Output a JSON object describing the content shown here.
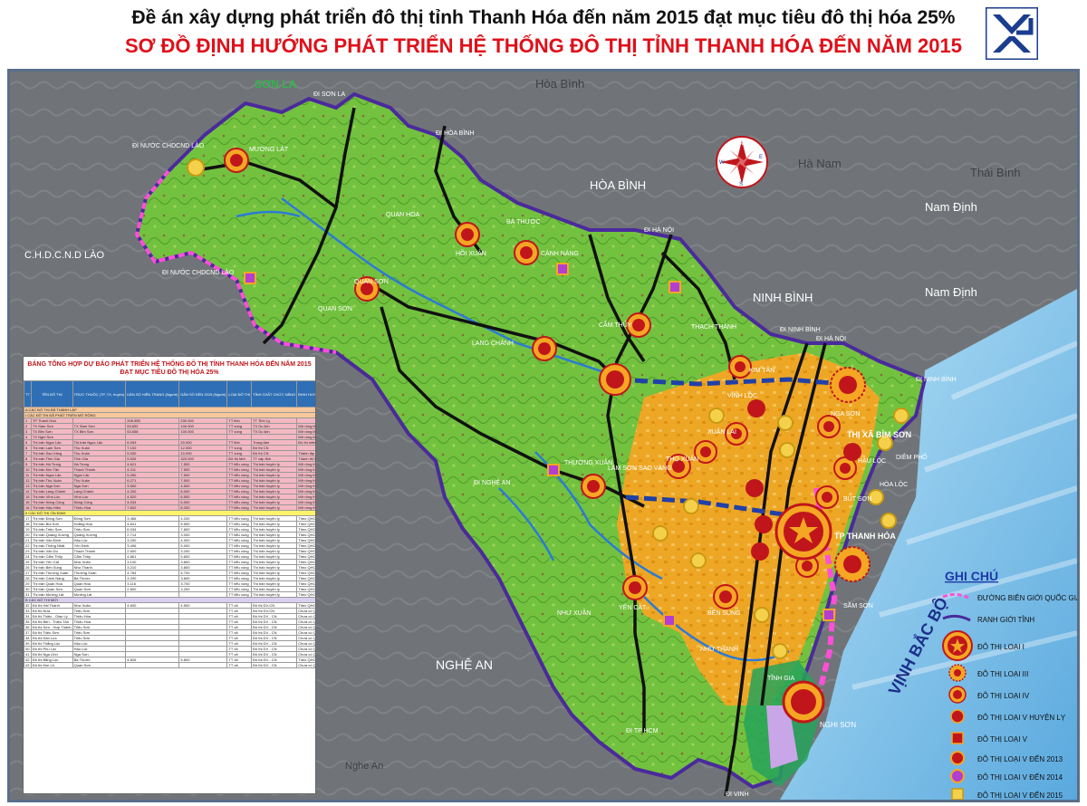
{
  "header": {
    "title_line1": "Đề án xây dựng phát triển đô thị tỉnh Thanh Hóa đến năm 2015 đạt mục tiêu đô thị hóa 25%",
    "title_line2": "SƠ ĐỒ ĐỊNH HƯỚNG PHÁT TRIỂN HỆ THỐNG ĐÔ THỊ TỈNH THANH HÓA ĐẾN NĂM 2015"
  },
  "colors": {
    "title_red": "#e0101a",
    "province_green": "#6fbf3a",
    "urban_orange": "#f4a52a",
    "sea_blue": "#9fd3f0",
    "background_gray": "#6e7276",
    "border_pink": "#ff4fd8",
    "border_purple": "#4b2a9c",
    "legend_title_blue": "#1f3aa8"
  },
  "region_labels": {
    "son_la": "SƠN LA",
    "hoa_binh_top": "Hòa Bình",
    "hoa_binh": "HÒA BÌNH",
    "ha_nam": "Hà Nam",
    "thai_binh": "Thái Bình",
    "nam_dinh_top": "Nam Định",
    "nam_dinh": "Nam Định",
    "ninh_binh": "NINH BÌNH",
    "lao": "C.H.D.C.N.D LÀO",
    "nghe_an": "NGHỆ AN",
    "nghe_an_small": "Nghe An",
    "vinh_bac_bo": "VỊNH BẮC BỘ"
  },
  "route_labels": {
    "di_son_la": "ĐI SƠN LA",
    "di_hoa_binh": "ĐI HÒA BÌNH",
    "di_lao_1": "ĐI NƯỚC CHDCND LÀO",
    "di_lao_2": "ĐI NƯỚC CHDCND LÀO",
    "di_ha_noi_1": "ĐI HÀ NỘI",
    "di_ha_noi_2": "ĐI HÀ NỘI",
    "di_ninh_binh_1": "ĐI NINH BÌNH",
    "di_ninh_binh_2": "ĐI NINH BÌNH",
    "di_nghe_an": "ĐI NGHỆ AN",
    "di_tp_hcm": "ĐI TP HCM",
    "di_vinh": "ĐI VINH"
  },
  "place_labels": {
    "muong_lat": "MƯỜNG LÁT",
    "quan_hoa": "QUAN HÓA",
    "hoi_xuan": "HỒI XUÂN",
    "ba_thuoc": "BÁ THƯỚC",
    "canh_nang": "CÀNH NÀNG",
    "quan_son_1": "QUAN SƠN",
    "quan_son_2": "QUAN SƠN",
    "cam_thuy": "CẨM THỦY",
    "lang_chanh": "LANG CHÁNH",
    "thach_thanh": "THẠCH THÀNH",
    "kim_tan": "KIM TÂN",
    "vinh_loc": "VĨNH LỘC",
    "thuong_xuan": "THƯỜNG XUÂN",
    "xuan_lai": "XUÂN LAI",
    "tho_xuan": "THỌ XUÂN",
    "lam_son": "LAM SƠN SAO VÀNG",
    "nhu_xuan": "NHƯ XUÂN",
    "yen_cat": "YÊN CÁT",
    "ben_sung": "BẾN SUNG",
    "nhu_thanh": "NHƯ THANH",
    "tinh_gia": "TĨNH GIA",
    "nghi_son": "NGHI SƠN",
    "tx_bim_son": "THỊ XÃ BỈM SƠN",
    "tp_thanh_hoa": "TP THANH HÓA",
    "sam_son": "SẦM SƠN",
    "hau_loc": "HẬU LỘC",
    "diem_pho": "DIÊM PHỐ",
    "but_son": "BÚT SƠN",
    "hoa_loc": "HÒA LỘC",
    "nga_son": "NGA SƠN"
  },
  "compass": {
    "n": "N",
    "s": "S",
    "e": "E",
    "w": "W"
  },
  "legend": {
    "title": "GHI CHÚ",
    "items": [
      {
        "label": "ĐƯỜNG BIÊN GIỚI QUỐC GIA",
        "icon": "dashed-border"
      },
      {
        "label": "RANH GIỚI TỈNH",
        "icon": "purple-border"
      },
      {
        "label": "ĐÔ THỊ LOẠI I",
        "icon": "large-star-circle"
      },
      {
        "label": "ĐÔ THỊ LOẠI III",
        "icon": "dotted-circle"
      },
      {
        "label": "ĐÔ THỊ LOẠI IV",
        "icon": "red-circle"
      },
      {
        "label": "ĐÔ THỊ LOẠI V HUYỆN LỴ",
        "icon": "red-circle-small"
      },
      {
        "label": "ĐÔ THỊ LOẠI V",
        "icon": "red-square"
      },
      {
        "label": "ĐÔ THỊ LOẠI V ĐẾN 2013",
        "icon": "orange-circle"
      },
      {
        "label": "ĐÔ THỊ LOẠI V ĐẾN 2014",
        "icon": "orange-circle-2"
      },
      {
        "label": "ĐÔ THỊ LOẠI V ĐẾN 2015",
        "icon": "yellow-square"
      }
    ]
  },
  "table": {
    "title_line1": "BẢNG TỔNG HỢP DỰ BÁO PHÁT TRIỂN HỆ THỐNG ĐÔ THỊ TỈNH THANH HÓA ĐẾN NĂM 2015",
    "title_line2": "ĐẠT MỤC TIÊU ĐÔ THỊ HÓA 25%",
    "headers": [
      "TT",
      "TÊN ĐÔ THỊ",
      "TRỰC THUỘC (TP, TX, huyện)",
      "DÂN SỐ HIỆN TRẠNG (Người)",
      "DÂN SỐ ĐẾN 2015 (Người)",
      "LOẠI ĐÔ THỊ",
      "TÍNH CHẤT CHỨC NĂNG",
      "ĐỊNH HƯỚNG PHÁT TRIỂN MỞ RỘNG",
      "QH CHUNG XÂY DỰNG",
      "GHI CHÚ"
    ],
    "sections": [
      {
        "class": "sec",
        "label": "A   CÁC ĐÔ THỊ ĐÃ THÀNH LẬP"
      },
      {
        "class": "sec",
        "label": "I   CÁC ĐÔ THỊ ĐÃ PHÁT TRIỂN MỞ RỘNG"
      }
    ],
    "rows_a": [
      [
        "1",
        "TP Thanh Hóa",
        "",
        "206.555",
        "230.000",
        "TT tỉnh",
        "TT Tỉnh Lỵ",
        "",
        "Đã được duyệt",
        ""
      ],
      [
        "2",
        "TX Sầm Sơn",
        "TX Sầm Sơn",
        "53.652",
        "100.000",
        "TT vùng",
        "TX Du lịch",
        "Mở rộng lên giới sang 19 xã",
        "Đã được duyệt",
        ""
      ],
      [
        "3",
        "TX Bỉm Sơn",
        "TX Bỉm Sơn",
        "53.658",
        "100.000",
        "TT vùng",
        "TX Du lịch",
        "Mở rộng lên giới sang 6 xã",
        "Cần điều chỉnh",
        ""
      ],
      [
        "4",
        "TX Nghi Sơn",
        "",
        "",
        "",
        "",
        "",
        "Mở rộng lên giới sang 5 xã",
        "",
        ""
      ],
      [
        "5",
        "Thị trấn Ngọc Lặc",
        "Thị trấn Ngọc Lặc",
        "6.053",
        "20.000",
        "TT tỉnh",
        "Trung tâm",
        "Đô thị miền núi phía Tây",
        "",
        ""
      ],
      [
        "6",
        "Thị trấn Lam Sơn",
        "Thọ Xuân",
        "7.100",
        "12.000",
        "TT vùng",
        "Đô thị CN",
        "",
        "Đã được duyệt",
        ""
      ],
      [
        "7",
        "Thị trấn Sao Vàng",
        "Thọ Xuân",
        "5.000",
        "10.000",
        "TT vùng",
        "Đô thị CN",
        "Thành lập thị xã LS-SV",
        "",
        ""
      ],
      [
        "8",
        "Thị trấn Tĩnh Gia",
        "Tĩnh Gia",
        "5.526",
        "320.000",
        "Đô thị Mới",
        "TT cấp tỉnh",
        "Thành thị Nghi Sơn - Tĩnh",
        "Đang lập QH",
        ""
      ],
      [
        "9",
        "Thị trấn Hà Trung",
        "Hà Trung",
        "4.621",
        "7.500",
        "TT tiểu vùng",
        "Thị trấn huyện lỵ",
        "Mở rộng theo QHC được duyệt",
        "Đã được duyệt",
        ""
      ],
      [
        "10",
        "Thị trấn Kim Tân",
        "Thạch Thành",
        "4.211",
        "7.500",
        "TT tiểu vùng",
        "Thị trấn huyện lỵ",
        "Mở rộng theo QHC được duyệt",
        "Đã được duyệt",
        ""
      ],
      [
        "11",
        "Thị trấn Ngọc Lặc",
        "Ngọc Lặc",
        "5.260",
        "7.500",
        "TT tiểu vùng",
        "Thị trấn huyện lỵ",
        "Mở rộng theo QHC được duyệt",
        "Đã được duyệt",
        ""
      ],
      [
        "12",
        "Thị trấn Thọ Xuân",
        "Thọ Xuân",
        "6.271",
        "7.500",
        "TT tiểu vùng",
        "Thị trấn huyện lỵ",
        "Mở rộng theo QHC được duyệt",
        "Đã được duyệt",
        ""
      ],
      [
        "13",
        "Thị trấn Nga Sơn",
        "Nga Sơn",
        "3.500",
        "4.500",
        "TT tiểu vùng",
        "Thị trấn huyện lỵ",
        "Mở rộng theo QHC được duyệt",
        "Đã được duyệt",
        ""
      ],
      [
        "14",
        "Thị trấn Lang Chánh",
        "Lang Chánh",
        "4.200",
        "6.000",
        "TT tiểu vùng",
        "Thị trấn huyện lỵ",
        "Mở rộng theo QHC được duyệt",
        "Đã được duyệt",
        ""
      ],
      [
        "15",
        "Thị trấn Vĩnh Lộc",
        "Vĩnh Lộc",
        "4.520",
        "6.500",
        "TT tiểu vùng",
        "Thị trấn huyện lỵ",
        "Mở rộng theo QHC được duyệt",
        "Đang lập QH",
        ""
      ],
      [
        "16",
        "Thị trấn Nông Cống",
        "Nông Cống",
        "4.034",
        "6.000",
        "TT tiểu vùng",
        "Thị trấn huyện lỵ",
        "Mở rộng theo QHC được duyệt",
        "Đang lập QH",
        ""
      ],
      [
        "16",
        "Thị trấn Hậu Hiền",
        "Thiệu Hóa",
        "7.602",
        "8.200",
        "TT tiểu vùng",
        "Thị trấn huyện lỵ",
        "Mở rộng theo QHC được duyệt",
        "Đang lập QH",
        ""
      ]
    ],
    "section_b1": "II   CÁC ĐÔ THỊ ỔN ĐỊNH",
    "rows_b1": [
      [
        "17",
        "Thị trấn Đông Sơn",
        "Đông Sơn",
        "3.466",
        "4.200",
        "TT tiểu vùng",
        "Thị trấn huyện lỵ",
        "Theo QHC được duyệt",
        "Đã được duyệt",
        ""
      ],
      [
        "18",
        "Thị trấn Bút Sơn",
        "Hoằng Hóa",
        "4.641",
        "5.500",
        "TT tiểu vùng",
        "Thị trấn huyện lỵ",
        "Theo QHC được duyệt",
        "Đã được duyệt",
        ""
      ],
      [
        "19",
        "Thị trấn Triệu Sơn",
        "Triệu Sơn",
        "6.034",
        "7.800",
        "TT tiểu vùng",
        "Thị trấn huyện lỵ",
        "Theo QHC được duyệt",
        "Đã được duyệt",
        ""
      ],
      [
        "20",
        "Thị trấn Quảng Xương",
        "Quảng Xương",
        "2.714",
        "3.000",
        "TT tiểu vùng",
        "Thị trấn huyện lỵ",
        "Theo QHC được duyệt",
        "Đã được duyệt",
        ""
      ],
      [
        "21",
        "Thị trấn Vân Định",
        "Hậu Lộc",
        "3.200",
        "4.000",
        "TT tiểu vùng",
        "Thị trấn huyện lỵ",
        "Theo QHC được duyệt",
        "Đã được duyệt",
        ""
      ],
      [
        "22",
        "Thị trấn Thống Nhất",
        "Yên Định",
        "3.496",
        "5.000",
        "TT tiểu vùng",
        "Thị trấn huyện lỵ",
        "Theo QHC được duyệt",
        "Đã được duyệt",
        ""
      ],
      [
        "23",
        "Thị trấn Vân Du",
        "Thạch Thành",
        "2.600",
        "3.200",
        "TT tiểu vùng",
        "Thị trấn huyện lỵ",
        "Theo QHC được duyệt",
        "Đã được duyệt",
        ""
      ],
      [
        "24",
        "Thị trấn Cẩm Thủy",
        "Cẩm Thủy",
        "4.861",
        "5.600",
        "TT tiểu vùng",
        "Thị trấn huyện lỵ",
        "Theo QHC được duyệt",
        "Đã được duyệt",
        ""
      ],
      [
        "25",
        "Thị trấn Yên Cát",
        "Như Xuân",
        "3.100",
        "3.800",
        "TT tiểu vùng",
        "Thị trấn huyện lỵ",
        "Theo QHC được duyệt",
        "Đã được duyệt",
        ""
      ],
      [
        "26",
        "Thị trấn Bến Sung",
        "Như Thanh",
        "3.210",
        "3.800",
        "TT tiểu vùng",
        "Thị trấn huyện lỵ",
        "Theo QHC được duyệt",
        "Đã được duyệt",
        ""
      ],
      [
        "27",
        "Thị trấn Thường Xuân",
        "Thường Xuân",
        "4.784",
        "5.700",
        "TT tiểu vùng",
        "Thị trấn huyện lỵ",
        "Theo QHC được duyệt",
        "Đã được duyệt",
        ""
      ],
      [
        "28",
        "Thị trấn Cành Nàng",
        "Bá Thước",
        "3.290",
        "3.800",
        "TT tiểu vùng",
        "Thị trấn huyện lỵ",
        "Theo QHC được duyệt",
        "Đã được duyệt",
        ""
      ],
      [
        "29",
        "Thị trấn Quan Hóa",
        "Quan Hóa",
        "3.116",
        "3.700",
        "TT tiểu vùng",
        "Thị trấn huyện lỵ",
        "Theo QHC được duyệt",
        "Đã được duyệt",
        ""
      ],
      [
        "30",
        "Thị trấn Quan Sơn",
        "Quan Sơn",
        "2.800",
        "3.200",
        "TT tiểu vùng",
        "Thị trấn huyện lỵ",
        "Theo QHC được duyệt",
        "Đã được duyệt",
        ""
      ],
      [
        "31",
        "Thị trấn Mường Lát",
        "Mường Lát",
        "",
        "",
        "TT tiểu vùng",
        "Thị trấn huyện lỵ",
        "Theo QHC được duyệt",
        "Đã được duyệt",
        ""
      ]
    ],
    "section_b": "B   CÁC ĐÔ THỊ MỚI",
    "rows_new": [
      [
        "32",
        "Đô thị Hải Thành",
        "Như Xuân",
        "4.600",
        "4.500",
        "TT xã",
        "Đô thị DV-CN",
        "Theo QHC được duyệt",
        "Đã được duyệt",
        ""
      ],
      [
        "33",
        "Đô thị Nưa",
        "Triệu Sơn",
        "",
        "",
        "TT xã",
        "Đô thị DV-CN",
        "Chưa có Quy hoạch Chung",
        "",
        ""
      ],
      [
        "34",
        "Đô thị Thiệu - Giao Lý",
        "Thiệu Hóa",
        "",
        "",
        "TT xã",
        "Đô thị DV - CN",
        "Chưa có Quy hoạch Chung",
        "",
        ""
      ],
      [
        "35",
        "Đô thị Bến - Thiệu Tân",
        "Thiệu Hóa",
        "",
        "",
        "TT xã",
        "Đô thị DV - CN",
        "Chưa có Quy hoạch Chung",
        "",
        ""
      ],
      [
        "36",
        "Đô thị Sơn - Hợp Thành",
        "Triệu Sơn",
        "",
        "",
        "TT xã",
        "Đô thị DV - CN",
        "Chưa có Quy hoạch Chung",
        "",
        ""
      ],
      [
        "37",
        "Đô thị Triệu Sơn",
        "Triệu Sơn",
        "",
        "",
        "TT xã",
        "Đô thị DV - CN",
        "Chưa có Quy hoạch Chung",
        "",
        ""
      ],
      [
        "38",
        "Đô thị Dân Lực",
        "Triệu Sơn",
        "",
        "",
        "TT xã",
        "Đô thị DV - CN",
        "Chưa có Quy hoạch Chung",
        "",
        ""
      ],
      [
        "39",
        "Đô thị Thắng Lộc",
        "Hậu Lộc",
        "",
        "",
        "TT xã",
        "Đô thị DV - CN",
        "Chưa có Quy hoạch Chung",
        "",
        ""
      ],
      [
        "40",
        "Đô thị Phú Lộc",
        "Hậu Lộc",
        "",
        "",
        "TT xã",
        "Đô thị DV - CN",
        "Chưa có Quy hoạch Chung",
        "",
        ""
      ],
      [
        "41",
        "Đô thị Nga Lĩnh",
        "Nga Sơn",
        "",
        "",
        "TT xã",
        "Đô thị DV - CN",
        "Chưa có Quy hoạch Chung",
        "",
        ""
      ],
      [
        "42",
        "Đô thị Bằng Lộc",
        "Bá Thước",
        "4.826",
        "5.800",
        "TT xã",
        "Đô thị DV - CN",
        "Theo QHC được duyệt",
        "Đang lập QH",
        ""
      ],
      [
        "43",
        "Đô thị Kim Lũ",
        "Quan Sơn",
        "",
        "",
        "TT xã",
        "Đô thị DV - CN",
        "Chưa có Quy hoạch Chung",
        "",
        ""
      ]
    ]
  }
}
